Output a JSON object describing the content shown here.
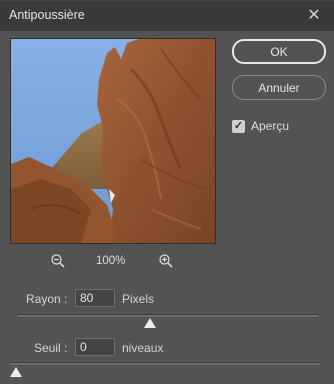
{
  "window": {
    "title": "Antipoussière"
  },
  "preview": {
    "zoom_label": "100%"
  },
  "buttons": {
    "ok": "OK",
    "cancel": "Annuler"
  },
  "preview_toggle": {
    "label": "Aperçu",
    "checked": true
  },
  "rayon": {
    "label": "Rayon :",
    "value": "80",
    "unit": "Pixels",
    "slider_fraction": 0.44
  },
  "seuil": {
    "label": "Seuil :",
    "value": "0",
    "unit": "niveaux",
    "slider_fraction": 0.0
  },
  "icons": {
    "close": "close-icon",
    "zoom_out": "zoom-out-icon",
    "zoom_in": "zoom-in-icon",
    "check": "checkmark-icon"
  }
}
